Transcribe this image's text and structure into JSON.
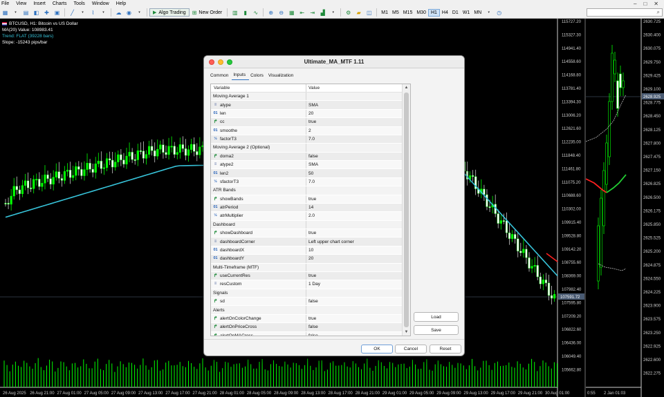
{
  "menu": {
    "items": [
      "File",
      "View",
      "Insert",
      "Charts",
      "Tools",
      "Window",
      "Help"
    ],
    "window_controls": [
      "–",
      "□",
      "✕"
    ]
  },
  "toolbar": {
    "algo_trading": "Algo Trading",
    "new_order": "New Order",
    "timeframes": [
      "M1",
      "M5",
      "M15",
      "M30",
      "H1",
      "H4",
      "D1",
      "W1",
      "MN"
    ],
    "active_timeframe": "H1"
  },
  "chart": {
    "symbol_line": "BTCUSD, H1: Bitcoin vs US Dollar",
    "ma_line": "MA(20) Value: 108983.41",
    "trend_line": "Trend: FLAT (39228 bars)",
    "slope_line": "Slope: -15243 pips/bar",
    "price_labels": [
      "115727.20",
      "115327.30",
      "114941.40",
      "114558.60",
      "114168.80",
      "113781.40",
      "113394.30",
      "113006.20",
      "112621.60",
      "112235.00",
      "111848.40",
      "111461.80",
      "111075.20",
      "110688.60",
      "110302.00",
      "109915.40",
      "109528.80",
      "109142.20",
      "108755.60",
      "108369.00",
      "107982.40",
      "107595.80",
      "107209.20",
      "106822.60",
      "106436.00",
      "106049.40",
      "105662.80"
    ],
    "current_price": "107591.72",
    "time_labels": [
      "26 Aug 2025",
      "26 Aug 21:00",
      "27 Aug 01:00",
      "27 Aug 05:00",
      "27 Aug 09:00",
      "27 Aug 13:00",
      "27 Aug 17:00",
      "27 Aug 21:00",
      "28 Aug 01:00",
      "28 Aug 05:00",
      "28 Aug 09:00",
      "28 Aug 13:00",
      "28 Aug 17:00",
      "28 Aug 21:00",
      "29 Aug 01:00",
      "29 Aug 05:00",
      "29 Aug 09:00",
      "29 Aug 13:00",
      "29 Aug 17:00",
      "29 Aug 21:00",
      "30 Aug 01:00"
    ],
    "colors": {
      "bull": "#00ff00",
      "bear": "#ffffff",
      "ma": "#37c3d9",
      "ma_down": "#ff2020"
    }
  },
  "chart_right": {
    "price_labels": [
      "2630.725",
      "2630.400",
      "2630.075",
      "2629.750",
      "2629.425",
      "2629.100",
      "2628.775",
      "2628.450",
      "2628.125",
      "2627.800",
      "2627.475",
      "2627.150",
      "2626.825",
      "2626.500",
      "2626.175",
      "2625.850",
      "2625.525",
      "2625.200",
      "2624.875",
      "2624.550",
      "2624.225",
      "2623.900",
      "2623.575",
      "2623.250",
      "2622.925",
      "2622.600",
      "2622.275"
    ],
    "current_price": "2628.925",
    "time_labels": [
      "0:55",
      "2 Jan 01:03"
    ]
  },
  "dialog": {
    "title": "Ultimate_MA_MTF 1.11",
    "tabs": [
      "Common",
      "Inputs",
      "Colors",
      "Visualization"
    ],
    "active_tab": "Inputs",
    "columns": [
      "Variable",
      "Value"
    ],
    "rows": [
      {
        "type": "section",
        "name": "Moving Average 1",
        "value": ""
      },
      {
        "type": "enum",
        "name": "atype",
        "value": "SMA"
      },
      {
        "type": "int",
        "name": "len",
        "value": "20"
      },
      {
        "type": "bool",
        "name": "cc",
        "value": "true"
      },
      {
        "type": "int",
        "name": "smoothe",
        "value": "2"
      },
      {
        "type": "dbl",
        "name": "factorT3",
        "value": "7.0"
      },
      {
        "type": "section",
        "name": "Moving Average 2 (Optional)",
        "value": ""
      },
      {
        "type": "bool",
        "name": "doma2",
        "value": "false"
      },
      {
        "type": "enum",
        "name": "atype2",
        "value": "SMA"
      },
      {
        "type": "int",
        "name": "len2",
        "value": "50"
      },
      {
        "type": "dbl",
        "name": "sfactorT3",
        "value": "7.0"
      },
      {
        "type": "section",
        "name": "ATR Bands",
        "value": ""
      },
      {
        "type": "bool",
        "name": "showBands",
        "value": "true"
      },
      {
        "type": "int",
        "name": "atrPeriod",
        "value": "14"
      },
      {
        "type": "dbl",
        "name": "atrMultiplier",
        "value": "2.0"
      },
      {
        "type": "section",
        "name": "Dashboard",
        "value": ""
      },
      {
        "type": "bool",
        "name": "showDashboard",
        "value": "true"
      },
      {
        "type": "enum",
        "name": "dashboardCorner",
        "value": "Left upper chart corner"
      },
      {
        "type": "int",
        "name": "dashboardX",
        "value": "10"
      },
      {
        "type": "int",
        "name": "dashboardY",
        "value": "20"
      },
      {
        "type": "section",
        "name": "Multi-Timeframe (MTF)",
        "value": ""
      },
      {
        "type": "bool",
        "name": "useCurrentRes",
        "value": "true"
      },
      {
        "type": "enum",
        "name": "resCustom",
        "value": "1 Day"
      },
      {
        "type": "section",
        "name": "Signals",
        "value": ""
      },
      {
        "type": "bool",
        "name": "sd",
        "value": "false"
      },
      {
        "type": "section",
        "name": "Alerts",
        "value": ""
      },
      {
        "type": "bool",
        "name": "alertOnColorChange",
        "value": "true"
      },
      {
        "type": "bool",
        "name": "alertOnPriceCross",
        "value": "false"
      },
      {
        "type": "bool",
        "name": "alertOnMACross",
        "value": "false"
      }
    ],
    "load_label": "Load",
    "save_label": "Save",
    "ok_label": "OK",
    "cancel_label": "Cancel",
    "reset_label": "Reset"
  }
}
